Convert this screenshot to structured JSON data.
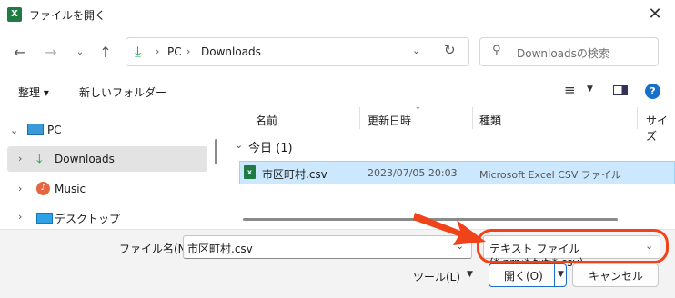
{
  "window": {
    "title": "ファイルを開く",
    "app_icon": "X"
  },
  "address": {
    "segments": [
      "PC",
      "Downloads"
    ]
  },
  "search": {
    "placeholder": "Downloadsの検索"
  },
  "toolbar": {
    "organize_label": "整理 ▾",
    "new_folder_label": "新しいフォルダー",
    "help_label": "?"
  },
  "sidebar": {
    "items": [
      {
        "label": "PC",
        "icon": "pc-icon"
      },
      {
        "label": "Downloads",
        "icon": "download-icon",
        "selected": true
      },
      {
        "label": "Music",
        "icon": "music-icon"
      },
      {
        "label": "デスクトップ",
        "icon": "desktop-icon"
      }
    ]
  },
  "columns": {
    "name": "名前",
    "modified": "更新日時",
    "type": "種類",
    "size": "サイズ"
  },
  "group": {
    "label": "今日 (1)"
  },
  "files": [
    {
      "name": "市区町村.csv",
      "modified": "2023/07/05 20:03",
      "type": "Microsoft Excel CSV ファイル"
    }
  ],
  "footer": {
    "filename_label": "ファイル名(N):",
    "filename_value": "市区町村.csv",
    "filter_value": "テキスト ファイル (*.prn;*.txt;*.csv)",
    "tools_label": "ツール(L)",
    "open_label": "開く(O)",
    "cancel_label": "キャンセル"
  },
  "annotation": {
    "accent": "#f0431a"
  }
}
